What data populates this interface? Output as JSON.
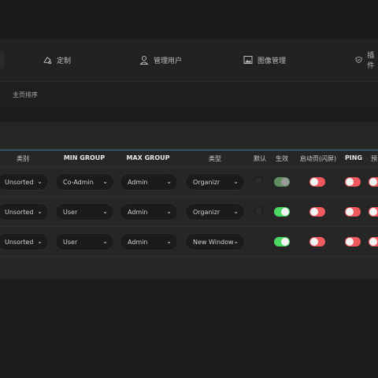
{
  "tabs": [
    {
      "label": "定制",
      "icon": "customize-icon"
    },
    {
      "label": "管理用户",
      "icon": "user-icon"
    },
    {
      "label": "图像管理",
      "icon": "image-icon"
    },
    {
      "label": "插件",
      "icon": "plugin-icon"
    }
  ],
  "section": {
    "title": "主页排序"
  },
  "table": {
    "headers": [
      "类别",
      "MIN GROUP",
      "MAX GROUP",
      "类型",
      "默认",
      "生效",
      "启动页(闪屏)",
      "PING",
      "预"
    ],
    "rows": [
      {
        "category": "Unsorted",
        "min_group": "Co-Admin",
        "max_group": "Admin",
        "type": "Organizr",
        "active": "on-grey",
        "splash": "off",
        "ping": "off",
        "preview": "off"
      },
      {
        "category": "Unsorted",
        "min_group": "User",
        "max_group": "Admin",
        "type": "Organizr",
        "active": "on",
        "splash": "off",
        "ping": "off",
        "preview": "off"
      },
      {
        "category": "Unsorted",
        "min_group": "User",
        "max_group": "Admin",
        "type": "New Window",
        "active": "on",
        "splash": "off",
        "ping": "off",
        "preview": "off"
      }
    ]
  },
  "colors": {
    "accent_line": "#3a7c9c",
    "toggle_on": "#4cd963",
    "toggle_off": "#f05a5f"
  }
}
